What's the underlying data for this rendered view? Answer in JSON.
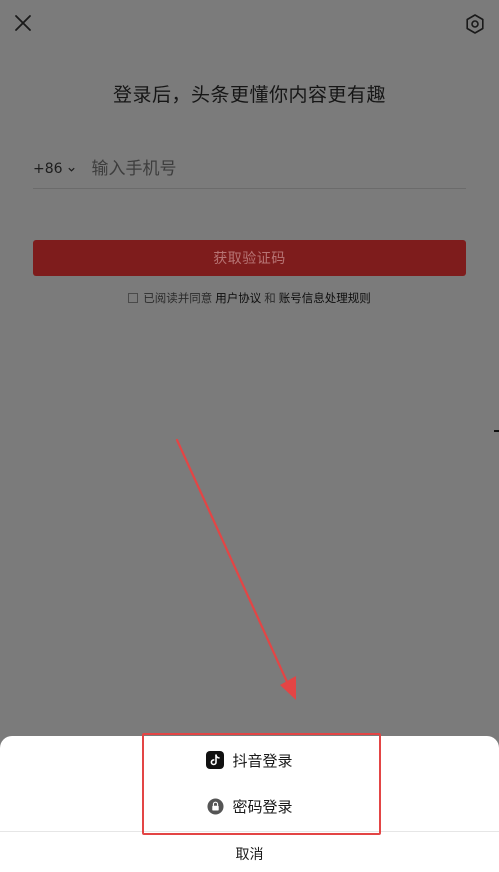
{
  "header": {
    "close_icon": "close-icon",
    "settings_icon": "settings-hex-icon"
  },
  "login": {
    "title": "登录后，头条更懂你内容更有趣",
    "country_code": "+86",
    "phone_placeholder": "输入手机号",
    "get_code_label": "获取验证码",
    "agree_prefix": "已阅读并同意",
    "user_agreement": "用户协议",
    "and": "和",
    "privacy_rules": "账号信息处理规则"
  },
  "sheet": {
    "douyin_login": "抖音登录",
    "password_login": "密码登录",
    "cancel": "取消"
  },
  "colors": {
    "overlay": "#7b7b7b",
    "button": "#7e1c1c",
    "annotation": "#e34545"
  }
}
